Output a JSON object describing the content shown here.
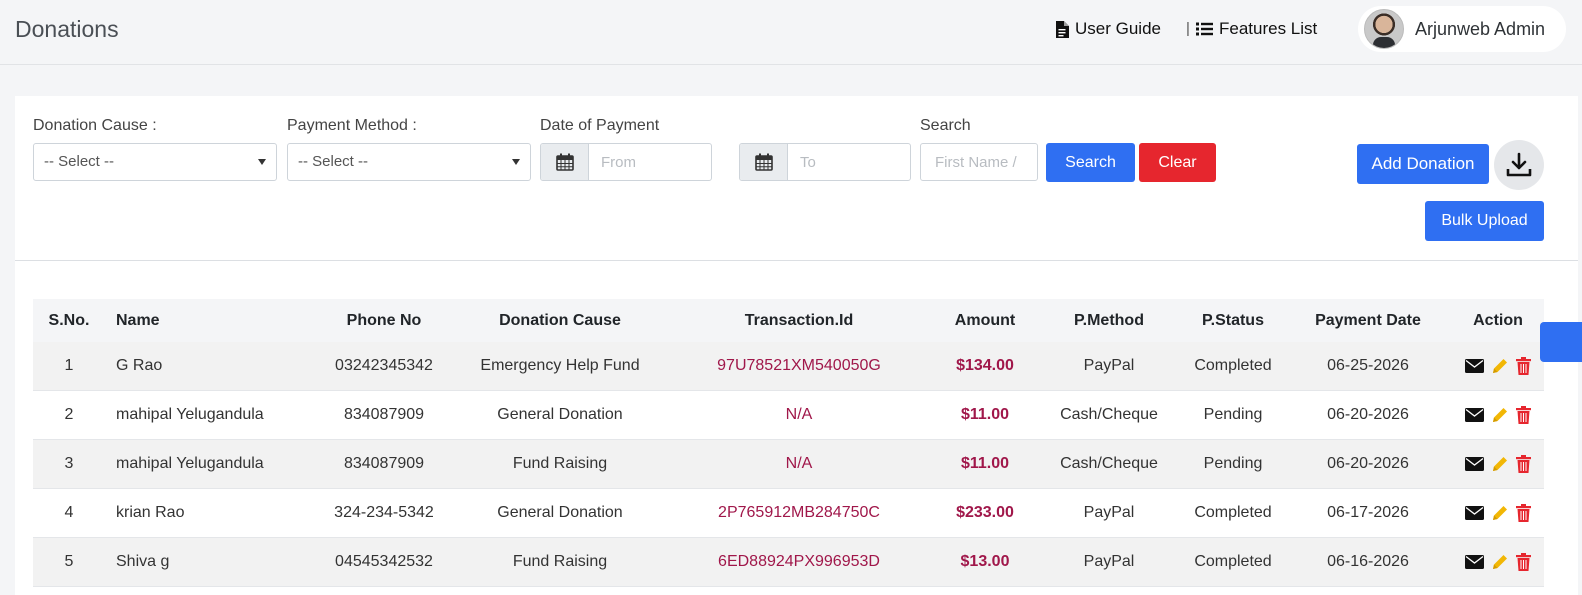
{
  "header": {
    "title": "Donations",
    "user_guide": "User Guide",
    "separator": "|",
    "features_list": "Features List",
    "user_name": "Arjunweb Admin"
  },
  "filters": {
    "cause_label": "Donation Cause :",
    "cause_value": "-- Select --",
    "method_label": "Payment Method :",
    "method_value": "-- Select --",
    "date_label": "Date of Payment",
    "from_placeholder": "From",
    "to_placeholder": "To",
    "search_label": "Search",
    "search_placeholder": "First Name /",
    "search_button": "Search",
    "clear_button": "Clear",
    "add_button": "Add Donation",
    "bulk_button": "Bulk Upload"
  },
  "table": {
    "headers": [
      "S.No.",
      "Name",
      "Phone No",
      "Donation Cause",
      "Transaction.Id",
      "Amount",
      "P.Method",
      "P.Status",
      "Payment Date",
      "Action"
    ],
    "rows": [
      {
        "sno": "1",
        "name": "G Rao",
        "phone": "03242345342",
        "cause": "Emergency Help Fund",
        "txn": "97U78521XM540050G",
        "amount": "$134.00",
        "method": "PayPal",
        "status": "Completed",
        "date": "06-25-2026"
      },
      {
        "sno": "2",
        "name": "mahipal Yelugandula",
        "phone": "834087909",
        "cause": "General Donation",
        "txn": "N/A",
        "amount": "$11.00",
        "method": "Cash/Cheque",
        "status": "Pending",
        "date": "06-20-2026"
      },
      {
        "sno": "3",
        "name": "mahipal Yelugandula",
        "phone": "834087909",
        "cause": "Fund Raising",
        "txn": "N/A",
        "amount": "$11.00",
        "method": "Cash/Cheque",
        "status": "Pending",
        "date": "06-20-2026"
      },
      {
        "sno": "4",
        "name": "krian Rao",
        "phone": "324-234-5342",
        "cause": "General Donation",
        "txn": "2P765912MB284750C",
        "amount": "$233.00",
        "method": "PayPal",
        "status": "Completed",
        "date": "06-17-2026"
      },
      {
        "sno": "5",
        "name": "Shiva g",
        "phone": "04545342532",
        "cause": "Fund Raising",
        "txn": "6ED88924PX996953D",
        "amount": "$13.00",
        "method": "PayPal",
        "status": "Completed",
        "date": "06-16-2026"
      }
    ]
  },
  "colors": {
    "primary": "#2f6ff2",
    "danger": "#e6262e",
    "accent_text": "#a0174a",
    "edit_icon": "#f2b705",
    "delete_icon": "#e6262e"
  },
  "icons": [
    "document-icon",
    "list-icon",
    "caret-down-icon",
    "calendar-icon",
    "download-icon",
    "envelope-icon",
    "pencil-icon",
    "trash-icon"
  ]
}
